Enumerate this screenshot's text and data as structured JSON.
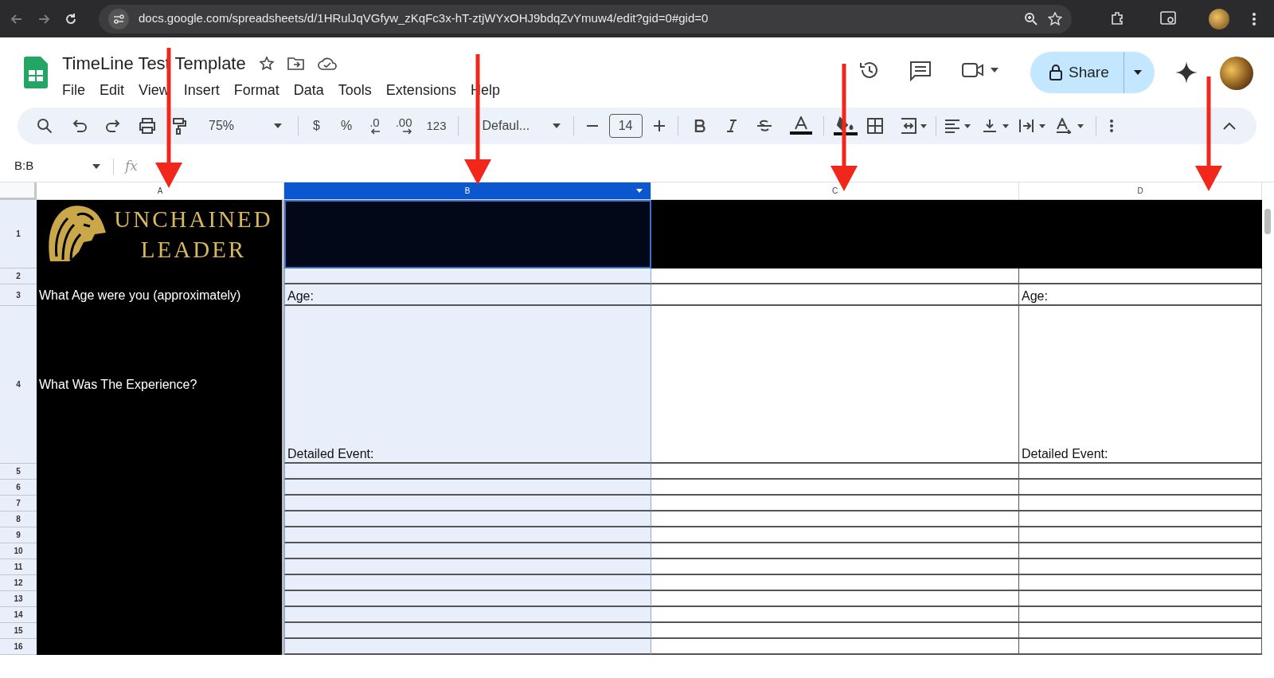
{
  "browser": {
    "url": "docs.google.com/spreadsheets/d/1HRulJqVGfyw_zKqFc3x-hT-ztjWYxOHJ9bdqZvYmuw4/edit?gid=0#gid=0"
  },
  "document": {
    "title": "TimeLine Test Template"
  },
  "menu": [
    "File",
    "Edit",
    "View",
    "Insert",
    "Format",
    "Data",
    "Tools",
    "Extensions",
    "Help"
  ],
  "share_button": "Share",
  "toolbar": {
    "zoom": "75%",
    "currency": "$",
    "percent": "%",
    "decrease_decimals": ".0",
    "increase_decimals": ".00",
    "number_format": "123",
    "font": "Defaul...",
    "font_size": "14"
  },
  "name_box": "B:B",
  "formula_label": "fx",
  "columns": [
    {
      "letter": "A",
      "selected": false
    },
    {
      "letter": "B",
      "selected": true
    },
    {
      "letter": "C",
      "selected": false
    },
    {
      "letter": "D",
      "selected": false
    }
  ],
  "logo": {
    "lines": [
      "UNCHAINED",
      "LEADER"
    ]
  },
  "rows": [
    {
      "number": "1",
      "cells": []
    },
    {
      "number": "2",
      "cells": []
    },
    {
      "number": "3",
      "cells": [
        "What Age were you (approximately)",
        "Age:",
        "",
        "Age:"
      ]
    },
    {
      "number": "4",
      "cells": [
        "What Was The Experience?",
        "Detailed Event:",
        "",
        "Detailed Event:"
      ]
    },
    {
      "number": "5",
      "cells": []
    },
    {
      "number": "6",
      "cells": []
    },
    {
      "number": "7",
      "cells": []
    },
    {
      "number": "8",
      "cells": []
    },
    {
      "number": "9",
      "cells": []
    },
    {
      "number": "10",
      "cells": []
    },
    {
      "number": "11",
      "cells": []
    },
    {
      "number": "12",
      "cells": []
    },
    {
      "number": "13",
      "cells": []
    },
    {
      "number": "14",
      "cells": []
    },
    {
      "number": "15",
      "cells": []
    },
    {
      "number": "16",
      "cells": []
    }
  ]
}
